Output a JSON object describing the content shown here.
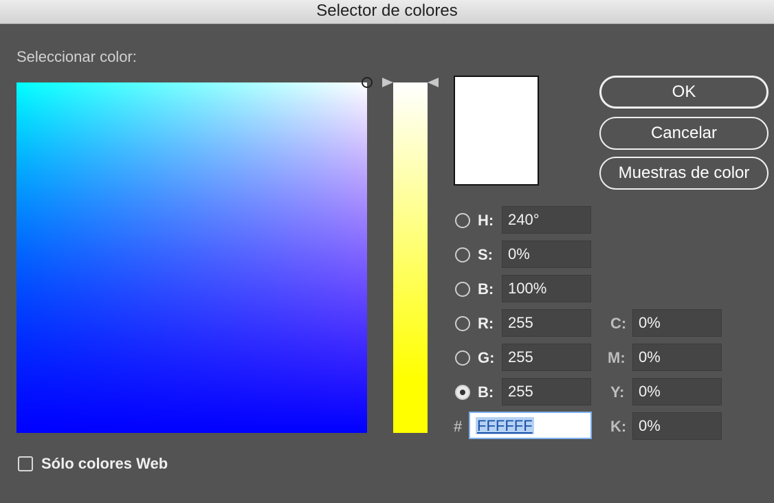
{
  "window": {
    "title": "Selector de colores"
  },
  "picker": {
    "section_label": "Seleccionar color:",
    "preview_color": "#ffffff"
  },
  "buttons": {
    "ok": "OK",
    "cancel": "Cancelar",
    "swatches": "Muestras de color"
  },
  "hsb": [
    {
      "label": "H:",
      "value": "240°"
    },
    {
      "label": "S:",
      "value": "0%"
    },
    {
      "label": "B:",
      "value": "100%"
    }
  ],
  "rgb": [
    {
      "label": "R:",
      "value": "255"
    },
    {
      "label": "G:",
      "value": "255"
    },
    {
      "label": "B:",
      "value": "255"
    }
  ],
  "cmyk": [
    {
      "label": "C:",
      "value": "0%"
    },
    {
      "label": "M:",
      "value": "0%"
    },
    {
      "label": "Y:",
      "value": "0%"
    },
    {
      "label": "K:",
      "value": "0%"
    }
  ],
  "hex": {
    "prefix": "#",
    "value": "FFFFFF"
  },
  "web_only": {
    "label": "Sólo colores Web",
    "checked": false
  },
  "selected_mode": "B (RGB)"
}
